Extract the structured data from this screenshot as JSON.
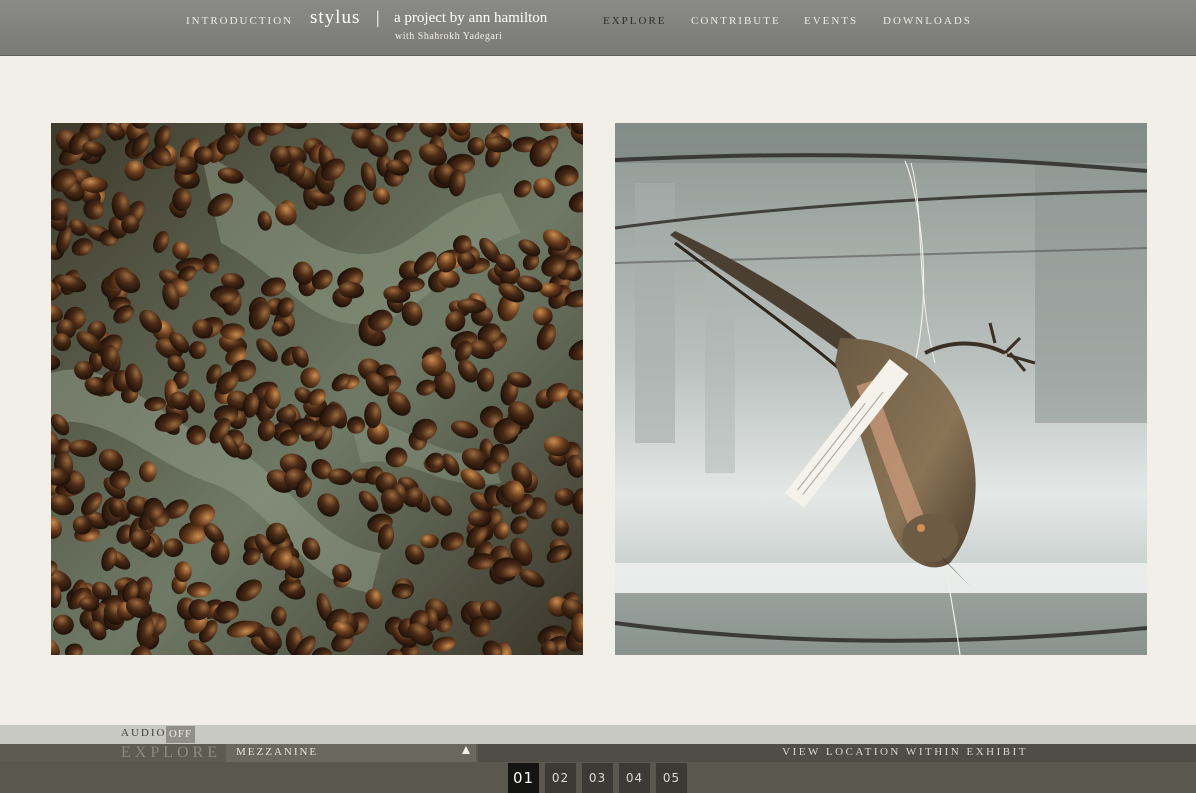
{
  "nav": {
    "left": {
      "label": "INTRODUCTION"
    },
    "brand": {
      "title": "stylus",
      "separator": "|",
      "subtitle": "a project by ann hamilton",
      "credit": "with Shahrokh Yadegari"
    },
    "right": [
      {
        "label": "EXPLORE",
        "active": true
      },
      {
        "label": "CONTRIBUTE",
        "active": false
      },
      {
        "label": "EVENTS",
        "active": false
      },
      {
        "label": "DOWNLOADS",
        "active": false
      }
    ]
  },
  "photos": [
    {
      "subject": "coffee beans scattered on a reflective surface"
    },
    {
      "subject": "taxidermy bird hanging upside down from wires with specimen tag"
    }
  ],
  "footer": {
    "audio_label": "AUDIO",
    "audio_state": "OFF",
    "section_label": "EXPLORE",
    "location": "MEZZANINE",
    "view_location": "VIEW LOCATION WITHIN EXHIBIT",
    "pages": [
      "01",
      "02",
      "03",
      "04",
      "05"
    ],
    "current_page": "01"
  },
  "colors": {
    "page_background": "#f1efe8",
    "nav_bar": "#7f7f7b",
    "footer_dark": "#4f4d45",
    "active_page": "#141412"
  },
  "icons": {
    "location_dropdown": "triangle-up-icon"
  }
}
